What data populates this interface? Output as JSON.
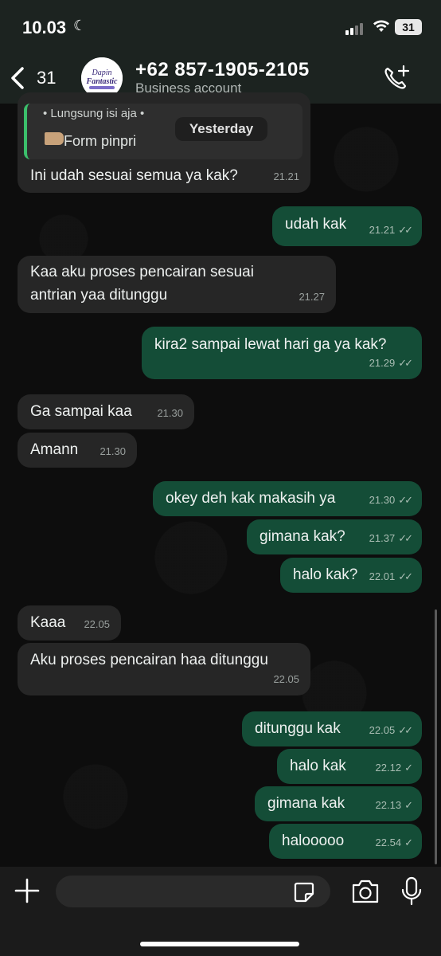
{
  "status_bar": {
    "time": "10.03",
    "battery": "31"
  },
  "header": {
    "back_count": "31",
    "contact_name": "+62 857-1905-2105",
    "contact_subtitle": "Business account",
    "avatar_text_line1": "Dapin",
    "avatar_text_line2": "Fantastic"
  },
  "quoted": {
    "top_text": "• Lungsung isi aja •",
    "form_label": "Form pinpri"
  },
  "date_chip": "Yesterday",
  "messages": [
    {
      "dir": "in",
      "text": "Ini udah sesuai semua ya kak?",
      "time": "21.21"
    },
    {
      "dir": "out",
      "text": "udah kak",
      "time": "21.21",
      "ticks": "✓✓"
    },
    {
      "dir": "in",
      "text": "Kaa aku proses pencairan sesuai antrian yaa ditunggu",
      "time": "21.27"
    },
    {
      "dir": "out",
      "text": "kira2 sampai lewat hari ga ya kak?",
      "time": "21.29",
      "ticks": "✓✓"
    },
    {
      "dir": "in",
      "text": "Ga sampai kaa",
      "time": "21.30"
    },
    {
      "dir": "in",
      "text": "Amann",
      "time": "21.30"
    },
    {
      "dir": "out",
      "text": "okey deh kak makasih ya",
      "time": "21.30",
      "ticks": "✓✓"
    },
    {
      "dir": "out",
      "text": "gimana kak?",
      "time": "21.37",
      "ticks": "✓✓"
    },
    {
      "dir": "out",
      "text": "halo kak?",
      "time": "22.01",
      "ticks": "✓✓"
    },
    {
      "dir": "in",
      "text": "Kaaa",
      "time": "22.05"
    },
    {
      "dir": "in",
      "text": "Aku proses pencairan haa ditunggu",
      "time": "22.05"
    },
    {
      "dir": "out",
      "text": "ditunggu kak",
      "time": "22.05",
      "ticks": "✓✓"
    },
    {
      "dir": "out",
      "text": "halo kak",
      "time": "22.12",
      "ticks": "✓"
    },
    {
      "dir": "out",
      "text": "gimana kak",
      "time": "22.13",
      "ticks": "✓"
    },
    {
      "dir": "out",
      "text": "halooooo",
      "time": "22.54",
      "ticks": "✓"
    }
  ],
  "composer": {
    "placeholder": ""
  },
  "colors": {
    "outgoing": "#144d37",
    "incoming": "#262626",
    "header": "#1c2320"
  }
}
